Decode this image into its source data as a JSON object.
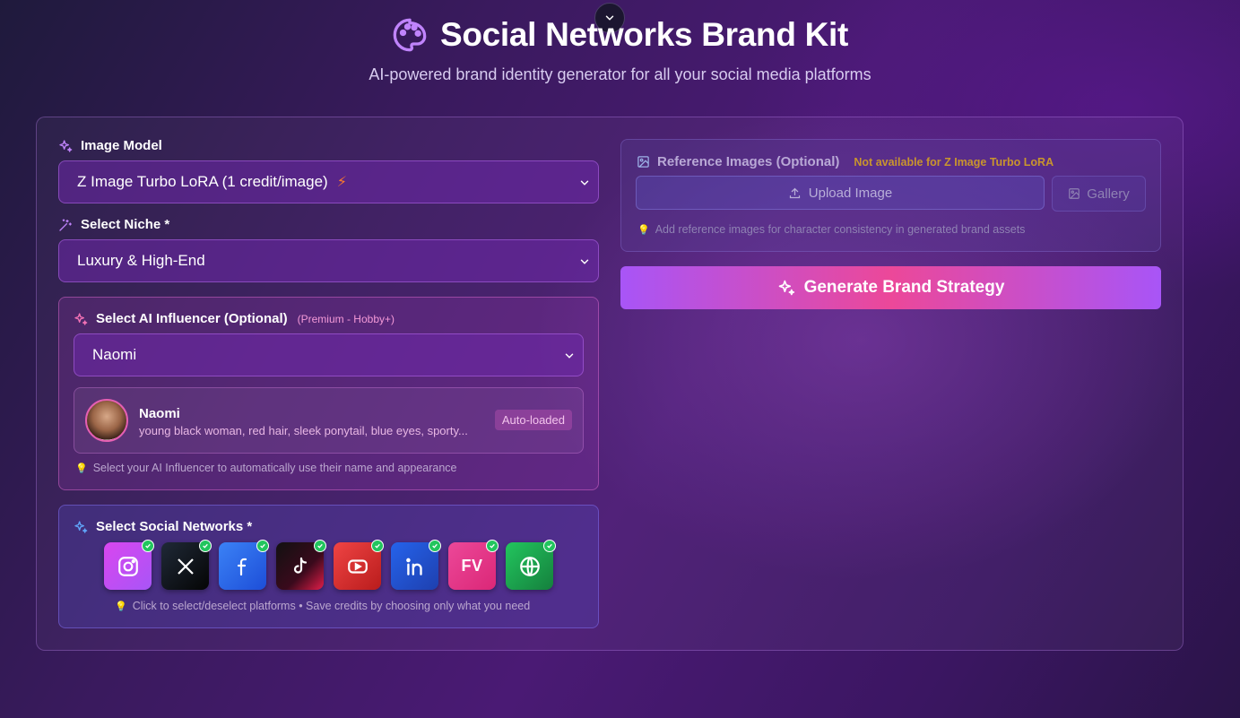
{
  "header": {
    "title": "Social Networks Brand Kit",
    "subtitle": "AI-powered brand identity generator for all your social media platforms"
  },
  "image_model": {
    "label": "Image Model",
    "value": "Z Image Turbo LoRA (1 credit/image)"
  },
  "niche": {
    "label": "Select Niche *",
    "value": "Luxury & High-End"
  },
  "influencer": {
    "label": "Select AI Influencer (Optional)",
    "premium_tag": "(Premium - Hobby+)",
    "value": "Naomi",
    "card_name": "Naomi",
    "card_description": "young black woman, red hair, sleek ponytail, blue eyes, sporty...",
    "badge": "Auto-loaded",
    "hint": "Select your AI Influencer to automatically use their name and appearance"
  },
  "social": {
    "label": "Select Social Networks *",
    "platforms": [
      {
        "name": "Instagram",
        "icon": "instagram-icon",
        "selected": true
      },
      {
        "name": "X",
        "icon": "x-icon",
        "selected": true
      },
      {
        "name": "Facebook",
        "icon": "facebook-icon",
        "selected": true
      },
      {
        "name": "TikTok",
        "icon": "tiktok-icon",
        "selected": true
      },
      {
        "name": "YouTube",
        "icon": "youtube-icon",
        "selected": true
      },
      {
        "name": "LinkedIn",
        "icon": "linkedin-icon",
        "selected": true
      },
      {
        "name": "FV",
        "icon": "fv-icon",
        "selected": true
      },
      {
        "name": "Website",
        "icon": "globe-icon",
        "selected": true
      }
    ],
    "fv_text": "FV",
    "hint": "Click to select/deselect platforms • Save credits by choosing only what you need"
  },
  "reference": {
    "label": "Reference Images (Optional)",
    "not_available": "Not available for Z Image Turbo LoRA",
    "upload_label": "Upload Image",
    "gallery_label": "Gallery",
    "hint": "Add reference images for character consistency in generated brand assets"
  },
  "generate": {
    "label": "Generate Brand Strategy"
  },
  "colors": {
    "accent_purple": "#a855f7",
    "accent_pink": "#ec4899",
    "warning": "#c9952d",
    "check_green": "#22c55e"
  }
}
